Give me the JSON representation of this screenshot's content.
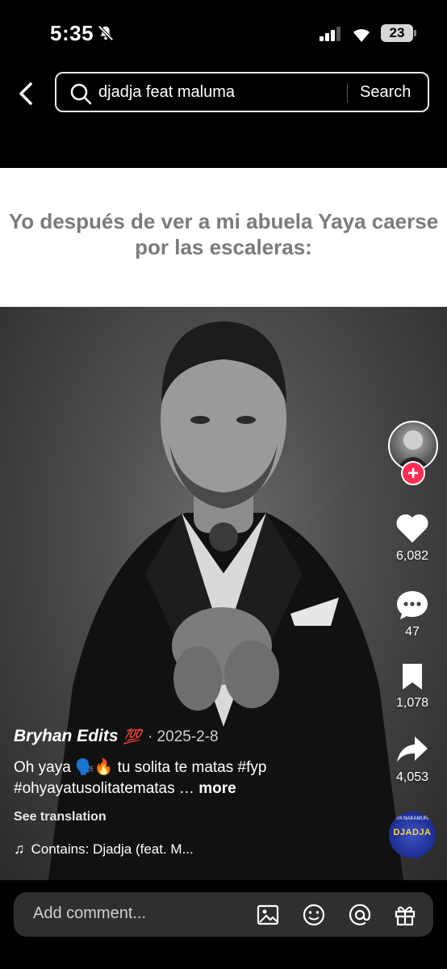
{
  "status_bar": {
    "time": "5:35",
    "battery": "23"
  },
  "search": {
    "query": "djadja feat maluma",
    "button_label": "Search"
  },
  "video": {
    "caption_overlay": "Yo después de ver a mi abuela Yaya caerse por las escaleras:"
  },
  "rail": {
    "likes": "6,082",
    "comments": "47",
    "saves": "1,078",
    "shares": "4,053",
    "follow_label": "+"
  },
  "post": {
    "author": "Bryhan Edits",
    "badge": "💯",
    "date": "· 2025-2-8",
    "description": "Oh yaya 🗣️🔥 tu solita te matas #fyp #ohyayatusolitatematas …",
    "more_label": "more",
    "see_translation": "See translation",
    "music": "Contains: Djadja (feat. M..."
  },
  "comment_bar": {
    "placeholder": "Add comment..."
  },
  "music_disc": {
    "label": "DJADJA",
    "sub_label": "AYA NAKAMURA"
  },
  "colors": {
    "accent_red": "#fe2c55",
    "background": "#000000"
  }
}
